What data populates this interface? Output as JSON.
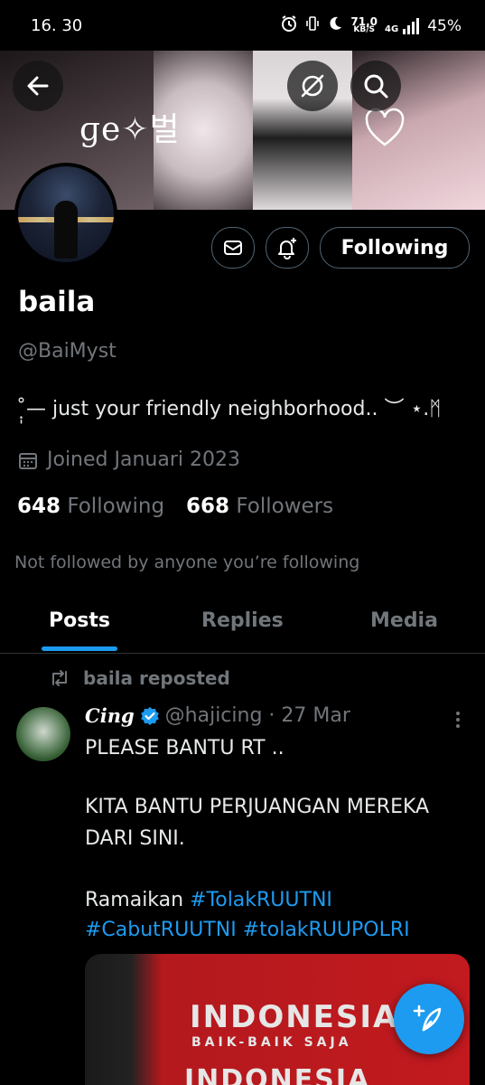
{
  "status_bar": {
    "time": "16. 30",
    "net_speed": "71,0",
    "net_unit": "KB/S",
    "network": "4G",
    "battery": "45%"
  },
  "banner": {
    "text": "ɡe✧벌",
    "icons": [
      "back-arrow-icon",
      "grok-icon",
      "search-icon"
    ]
  },
  "profile": {
    "following_button": "Following",
    "name": "baila",
    "handle": "@BaiMyst",
    "bio": "˚̣̩— just your friendly neighborhood.. ︶ ⋆.ᛗ",
    "joined": "Joined Januari 2023",
    "following_count": "648",
    "following_label": "Following",
    "followers_count": "668",
    "followers_label": "Followers",
    "not_followed": "Not followed by anyone you’re following"
  },
  "tabs": [
    {
      "label": "Posts",
      "active": true
    },
    {
      "label": "Replies",
      "active": false
    },
    {
      "label": "Media",
      "active": false
    }
  ],
  "post": {
    "repost_label": "baila reposted",
    "author": "Cing",
    "handle_time": "@hajicing · 27 Mar",
    "lines": [
      "PLEASE BANTU RT ..",
      "KITA BANTU PERJUANGAN MEREKA",
      "DARI SINI.",
      "Ramaikan "
    ],
    "hashtags": [
      "#TolakRUUTNI",
      "#CabutRUUTNI",
      "#tolakRUUPOLRI"
    ],
    "media_title": "INDONESIA",
    "media_subtitle": "BAIK-BAIK SAJA",
    "media_bottom": "INDONESIA"
  },
  "colors": {
    "accent": "#1d9bf0",
    "muted": "#71767b",
    "background": "#000000"
  }
}
